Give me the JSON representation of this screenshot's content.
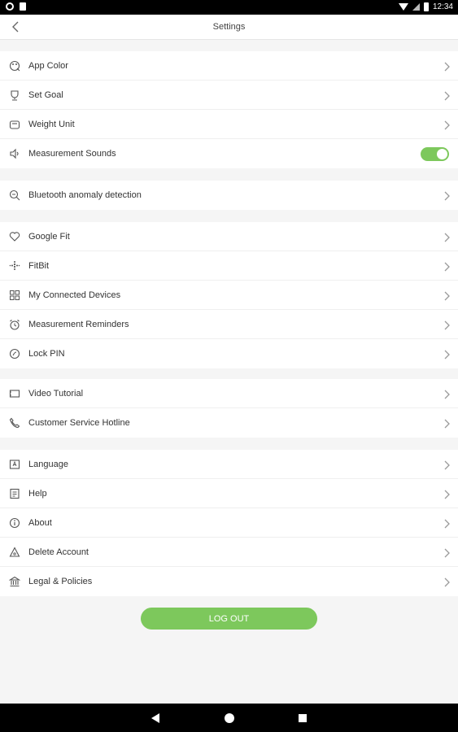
{
  "status_bar": {
    "time": "12:34"
  },
  "header": {
    "title": "Settings"
  },
  "groups": [
    {
      "items": [
        {
          "label": "App Color",
          "icon": "palette-icon",
          "control": "chevron"
        },
        {
          "label": "Set Goal",
          "icon": "trophy-icon",
          "control": "chevron"
        },
        {
          "label": "Weight Unit",
          "icon": "scale-icon",
          "control": "chevron"
        },
        {
          "label": "Measurement Sounds",
          "icon": "speaker-icon",
          "control": "toggle",
          "toggle_on": true
        }
      ]
    },
    {
      "items": [
        {
          "label": "Bluetooth anomaly detection",
          "icon": "search-icon",
          "control": "chevron"
        }
      ]
    },
    {
      "items": [
        {
          "label": "Google Fit",
          "icon": "heart-icon",
          "control": "chevron"
        },
        {
          "label": "FitBit",
          "icon": "fitbit-icon",
          "control": "chevron"
        },
        {
          "label": "My Connected Devices",
          "icon": "devices-grid-icon",
          "control": "chevron"
        },
        {
          "label": "Measurement Reminders",
          "icon": "alarm-clock-icon",
          "control": "chevron"
        },
        {
          "label": "Lock PIN",
          "icon": "lock-icon",
          "control": "chevron"
        }
      ]
    },
    {
      "items": [
        {
          "label": "Video Tutorial",
          "icon": "video-icon",
          "control": "chevron"
        },
        {
          "label": "Customer Service Hotline",
          "icon": "phone-icon",
          "control": "chevron"
        }
      ]
    },
    {
      "items": [
        {
          "label": "Language",
          "icon": "language-icon",
          "control": "chevron"
        },
        {
          "label": "Help",
          "icon": "help-icon",
          "control": "chevron"
        },
        {
          "label": "About",
          "icon": "info-icon",
          "control": "chevron"
        },
        {
          "label": "Delete Account",
          "icon": "delete-account-icon",
          "control": "chevron"
        },
        {
          "label": "Legal & Policies",
          "icon": "bank-icon",
          "control": "chevron"
        }
      ]
    }
  ],
  "logout": {
    "label": "LOG OUT"
  },
  "colors": {
    "accent": "#7dc85c",
    "background": "#f5f5f5",
    "text": "#333333",
    "icon": "#555555",
    "chevron": "#9a9a9a"
  }
}
